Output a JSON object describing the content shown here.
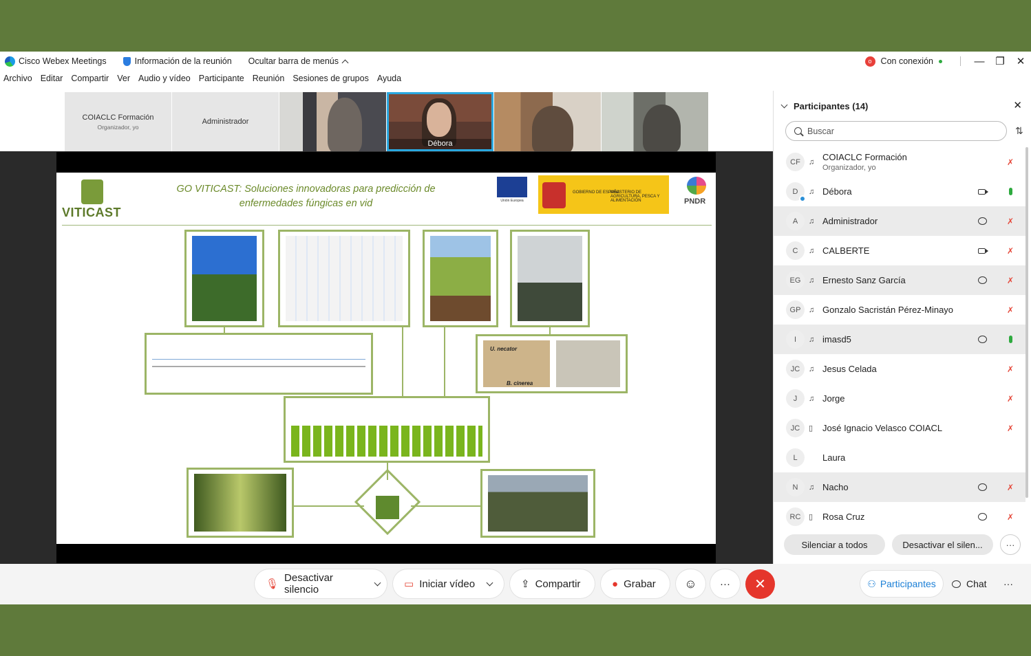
{
  "titlebar": {
    "app_name": "Cisco Webex Meetings",
    "meeting_info": "Información de la reunión",
    "hide_menu": "Ocultar barra de menús",
    "connection": "Con conexión",
    "rec_symbol": "o",
    "minimize": "—",
    "restore": "❐",
    "close": "✕"
  },
  "menu": [
    "Archivo",
    "Editar",
    "Compartir",
    "Ver",
    "Audio y vídeo",
    "Participante",
    "Reunión",
    "Sesiones de grupos",
    "Ayuda"
  ],
  "video_strip": {
    "tile1_name": "COIACLC Formación",
    "tile1_sub": "Organizador, yo",
    "tile2_name": "Administrador",
    "active_speaker": "Débora"
  },
  "slide": {
    "title": "GO VITICAST: Soluciones innovadoras para predicción de enfermedades fúngicas en vid",
    "logo_text": "VITICAST",
    "eu_label": "Unión Europea",
    "gov_label": "GOBIERNO DE ESPAÑA",
    "ministry_label": "MINISTERIO DE AGRICULTURA, PESCA Y ALIMENTACIÓN",
    "pndr_label": "PNDR",
    "micro_label_1": "U. necator",
    "micro_label_2": "B. cinerea"
  },
  "participants": {
    "header": "Participantes (14)",
    "search_placeholder": "Buscar",
    "list": [
      {
        "initials": "CF",
        "name": "COIACLC Formación",
        "sub": "Organizador, yo",
        "mute": "✗"
      },
      {
        "initials": "D",
        "name": "Débora",
        "sub": ""
      },
      {
        "initials": "A",
        "name": "Administrador",
        "sub": "",
        "mute": "✗"
      },
      {
        "initials": "C",
        "name": "CALBERTE",
        "sub": "",
        "mute": "✗"
      },
      {
        "initials": "EG",
        "name": "Ernesto Sanz García",
        "sub": "",
        "mute": "✗"
      },
      {
        "initials": "GP",
        "name": "Gonzalo Sacristán Pérez-Minayo",
        "sub": "",
        "mute": "✗"
      },
      {
        "initials": "I",
        "name": "imasd5",
        "sub": ""
      },
      {
        "initials": "JC",
        "name": "Jesus Celada",
        "sub": "",
        "mute": "✗"
      },
      {
        "initials": "J",
        "name": "Jorge",
        "sub": "",
        "mute": "✗"
      },
      {
        "initials": "JC",
        "name": "José Ignacio Velasco COIACL",
        "sub": "",
        "mute": "✗"
      },
      {
        "initials": "L",
        "name": "Laura",
        "sub": ""
      },
      {
        "initials": "N",
        "name": "Nacho",
        "sub": "",
        "mute": "✗"
      },
      {
        "initials": "RC",
        "name": "Rosa Cruz",
        "sub": "",
        "mute": "✗"
      }
    ],
    "mute_all": "Silenciar a todos",
    "unmute_all": "Desactivar el silen...",
    "more": "···"
  },
  "toolbar": {
    "unmute": "Desactivar silencio",
    "start_video": "Iniciar vídeo",
    "share": "Compartir",
    "record": "Grabar",
    "reactions": "☺",
    "more": "···",
    "end": "✕",
    "participants": "Participantes",
    "chat": "Chat",
    "more_right": "···"
  },
  "colors": {
    "background": "#5f7a3b",
    "accent": "#1b7fd6",
    "end_call": "#e5362c",
    "slide_green": "#9cb566"
  }
}
